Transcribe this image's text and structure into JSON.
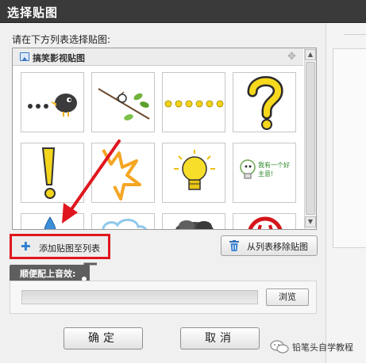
{
  "window": {
    "title": "选择贴图"
  },
  "instruction": "请在下方列表选择贴图:",
  "sticker_list": {
    "category": "搞笑影视贴图",
    "icons": {
      "category": "image-icon",
      "move": "move-icon"
    }
  },
  "stickers": [
    {
      "name": "dots-and-bird"
    },
    {
      "name": "branch-with-leaves"
    },
    {
      "name": "yellow-dots"
    },
    {
      "name": "question-mark"
    },
    {
      "name": "exclamation-mark"
    },
    {
      "name": "spiky-burst"
    },
    {
      "name": "light-bulb"
    },
    {
      "name": "idea-bulb-with-text",
      "text": "我有一个好主意!"
    },
    {
      "name": "water-drop"
    },
    {
      "name": "cloud"
    },
    {
      "name": "dark-smoke"
    },
    {
      "name": "red-sign"
    }
  ],
  "buttons": {
    "add": "添加贴图至列表",
    "remove": "从列表移除贴图",
    "browse": "浏览",
    "ok": "确定",
    "cancel": "取消"
  },
  "sound": {
    "tab_label": "顺便配上音效:",
    "path_value": ""
  },
  "watermark": "铅笔头自学教程",
  "colors": {
    "annotation_red": "#e0161f",
    "titlebar": "#3a3a3a",
    "accent_blue": "#2f7fd0"
  }
}
